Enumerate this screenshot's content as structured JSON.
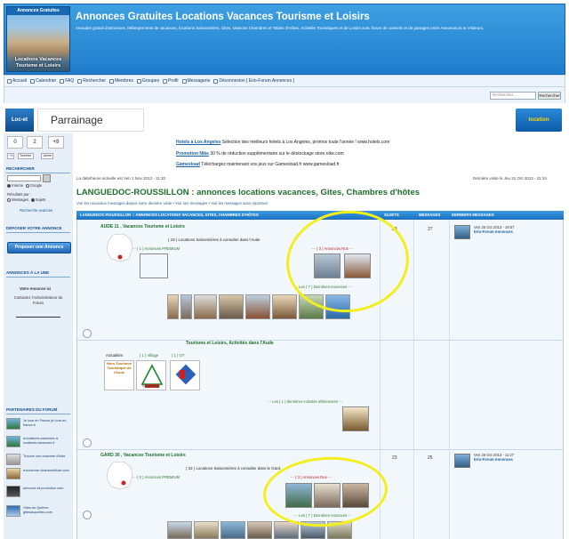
{
  "header": {
    "logo_tag": "Annonces Gratuites",
    "logo_bottom_1": "Locations Vacances",
    "logo_bottom_2": "Tourisme et Loisirs",
    "title": "Annonces Gratuites Locations Vacances Tourisme et Loisirs",
    "description": "Annuaire gratuit d'annonces, hébergements de vacances, locations Saisonnières, Gites, Maisons Chambres et Tables d'Hôtes, Activités Touristiques et de Loisirs avec forum de conseils et de partages entre Annonceurs et Visiteurs."
  },
  "nav": {
    "items": [
      "Accueil",
      "Calendrier",
      "FAQ",
      "Rechercher",
      "Membres",
      "Groupes",
      "Profil",
      "Messagerie",
      "Déconnexion [ Erio-Forum Annonces ]"
    ]
  },
  "search": {
    "placeholder": "Rechercher...",
    "button": "Rechercher"
  },
  "parrainage": {
    "left_logo": "Loc-et",
    "label": "Parrainage",
    "right_logo": "location"
  },
  "sidebar": {
    "stat1": "0",
    "stat2": "2",
    "stat3": "+8",
    "share_tweet": "Tweeter",
    "share_gplus": "+1",
    "share_mail": "Jaime",
    "rechercher_head": "RECHERCHER",
    "opt_internet": "Interne",
    "opt_google": "Google",
    "results_label": "Résultats par :",
    "opt_messages": "Messages",
    "opt_sujets": "Sujets",
    "advanced": "Recherche avancée",
    "deposer_head": "DÉPOSER VOTRE ANNONCE",
    "deposer_button": "Proposer une Annonce",
    "une_head": "ANNONCES À LA UNE",
    "une_title": "Votre Annonce ici",
    "une_text": "Contactez l'Administrateur du Forum",
    "partners_head": "PARTENAIRES DU FORUM",
    "partners": [
      "Je loue en France je-loue-en-france.fr",
      "a-locations-vacances a-locations-vacances.fr",
      "Trouver une chambre d'hôte",
      "trouverune chambredhote.com",
      "annonce-et-promotion.com",
      "Gites du Québec gitesduquebec.com"
    ]
  },
  "ads": [
    {
      "title": "Hotels à Los Angeles",
      "text": "Sélection des meilleurs hotels à Los Angeles, promos toute l'année ! www.hotels.com"
    },
    {
      "title": "Promotion Nike",
      "text": "30 % de réduction supplémentaire sur le déstockage store.nike.com"
    },
    {
      "title": "Gamesload",
      "text": "Téléchargez maintenant vos jeux sur Gamesload.fr www.gamesload.fr"
    }
  ],
  "date_line": "La date/heure actuelle est Ven 1 Nov 2013 - 11:33",
  "last_visit": "Dernière visite le Jeu 31 Oct 2013 - 21:34",
  "page_title": "LANGUEDOC-ROUSSILLON : annonces locations vacances, Gites, Chambres d'hôtes",
  "view_links": "Voir les nouveaux messages depuis votre dernière visite • Voir ses messages • Voir les messages sans réponses",
  "table_head": {
    "crumb": "LANGUEDOC-ROUSSILLON :: ANNONCES LOCATIONS VACANCES, GITES, CHAMBRES D'HÔTES",
    "sujets": "SUJETS",
    "messages": "MESSAGES",
    "last": "DERNIERS MESSAGES"
  },
  "forums": [
    {
      "title": "AUDE 11 , Vacances Tourisme et Loisirs",
      "locations": "( 19 ) Locations Saisonnières à consulter dans l'Aude",
      "premium": "- - ( 1 ) Annonces PREMIUM",
      "rus": "- - ( 3 ) Annonces Rus - -",
      "dernieres": "- - Les ( 7 ) Dernières Annonces - -",
      "sujets": "23",
      "messages": "27",
      "last_date": "Ven 25 Oct 2013 - 19:57",
      "last_author": "Erio-Forum Annonces"
    },
    {
      "title": "Tourisme et Loisirs, Activités dans l'Aude",
      "actualites": "Actualités",
      "village": "( 1 ) Village",
      "ot": "( 1 ) OT",
      "badge1": "Hors Tourisme Touristique de l'Aude",
      "badge2": "Village Etape",
      "dernieres": "- - Les ( 1 ) dernières Activités référencées - -"
    },
    {
      "title": "GARD 30 , Vacances Tourisme et Loisirs",
      "locations": "( 32 ) Locations Saisonnières à consulter dans le Gard.",
      "premium": "- - ( 0 ) Annonces PREMIUM",
      "rus": "- - ( 3 ) Annonces Rus - -",
      "dernieres": "- - Les ( 7 ) Dernières Annonces - -",
      "sujets": "23",
      "messages": "25",
      "last_date": "Ven 25 Oct 2013 - 11:27",
      "last_author": "Erio-Forum Annonces"
    }
  ],
  "colors": {
    "header_blue": "#2a8ad8",
    "title_green": "#1d6f2a",
    "highlight": "#f2ef1c"
  }
}
